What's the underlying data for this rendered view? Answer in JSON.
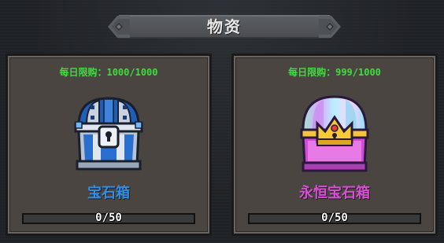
{
  "header": {
    "title": "物资"
  },
  "cards": [
    {
      "limit_label": "每日限购：",
      "limit_value": "1000/1000",
      "name": "宝石箱",
      "progress_text": "0/50",
      "progress_fraction": 0,
      "icon": "blue-gem-chest-icon",
      "name_color": "#2e8fe8"
    },
    {
      "limit_label": "每日限购：",
      "limit_value": "999/1000",
      "name": "永恒宝石箱",
      "progress_text": "0/50",
      "progress_fraction": 0,
      "icon": "rainbow-crown-chest-icon",
      "name_color": "#d84fd6"
    }
  ],
  "colors": {
    "limit_text": "#3dde3d",
    "card_bg": "#4a4541",
    "background": "#1f2226"
  }
}
